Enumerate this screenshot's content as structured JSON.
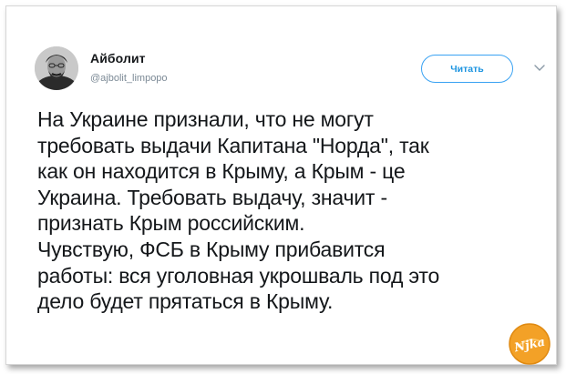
{
  "tweet": {
    "author": {
      "display_name": "Айболит",
      "handle": "@ajbolit_limpopo"
    },
    "follow_label": "Читать",
    "text": "На Украине признали, что не могут\nтребовать выдачи Капитана \"Норда\", так\nкак он находится в Крыму, а Крым - це\nУкраина. Требовать выдачу, значит -\nпризнать Крым российским.\nЧувствую, ФСБ в Крыму прибавится\nработы: вся уголовная укрошваль под это\nдело будет прятаться в Крыму."
  },
  "icons": {
    "avatar": "avatar-portrait",
    "menu": "chevron-down-icon",
    "watermark": "site-logo-badge"
  },
  "watermark": {
    "text": "Njka"
  },
  "colors": {
    "accent": "#1da1f2",
    "text": "#14171a",
    "muted": "#657786",
    "watermark_orange": "#f3a127"
  }
}
